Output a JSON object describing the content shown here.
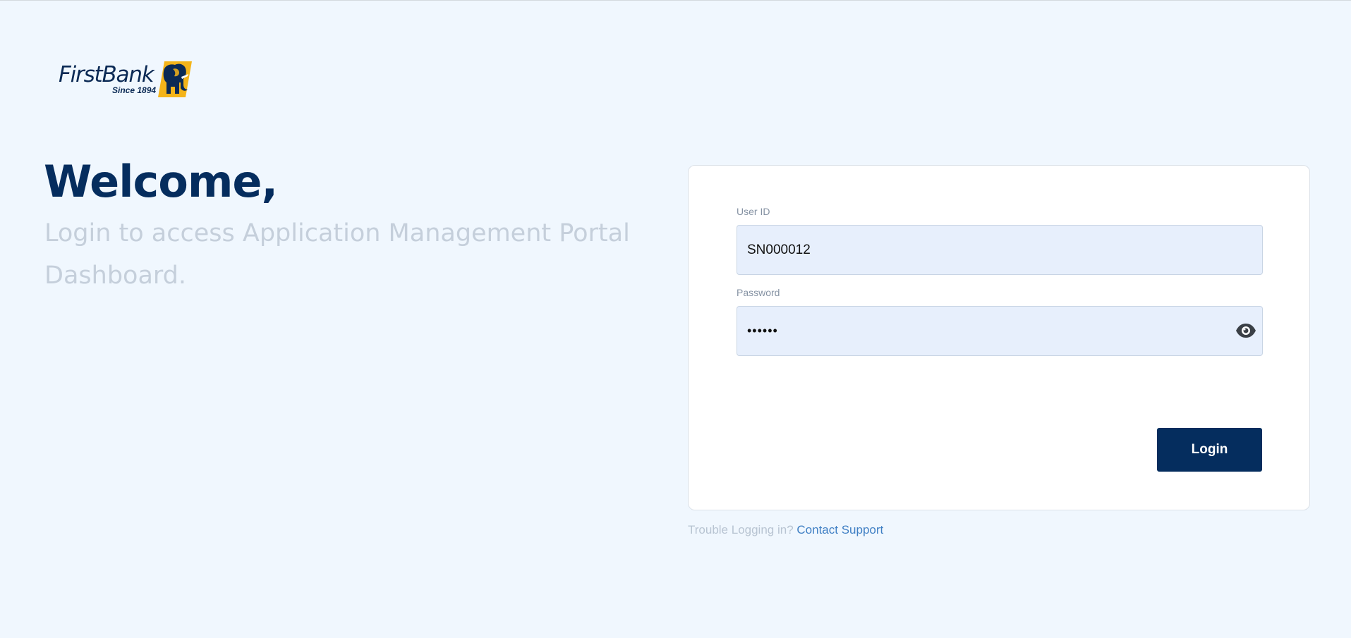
{
  "brand": {
    "name": "FirstBank",
    "tagline": "Since 1894",
    "colors": {
      "primary": "#052d5e",
      "accent": "#f4b41a",
      "background": "#f0f7fe",
      "link": "#3f7fc4"
    }
  },
  "hero": {
    "title": "Welcome,",
    "subtitle": "Login to access Application Management Portal Dashboard."
  },
  "login_form": {
    "user_id": {
      "label": "User ID",
      "value": "SN000012"
    },
    "password": {
      "label": "Password",
      "value": "••••••",
      "toggle_icon": "eye-icon"
    },
    "submit_label": "Login"
  },
  "help": {
    "text": "Trouble Logging in?",
    "link_label": "Contact Support"
  }
}
